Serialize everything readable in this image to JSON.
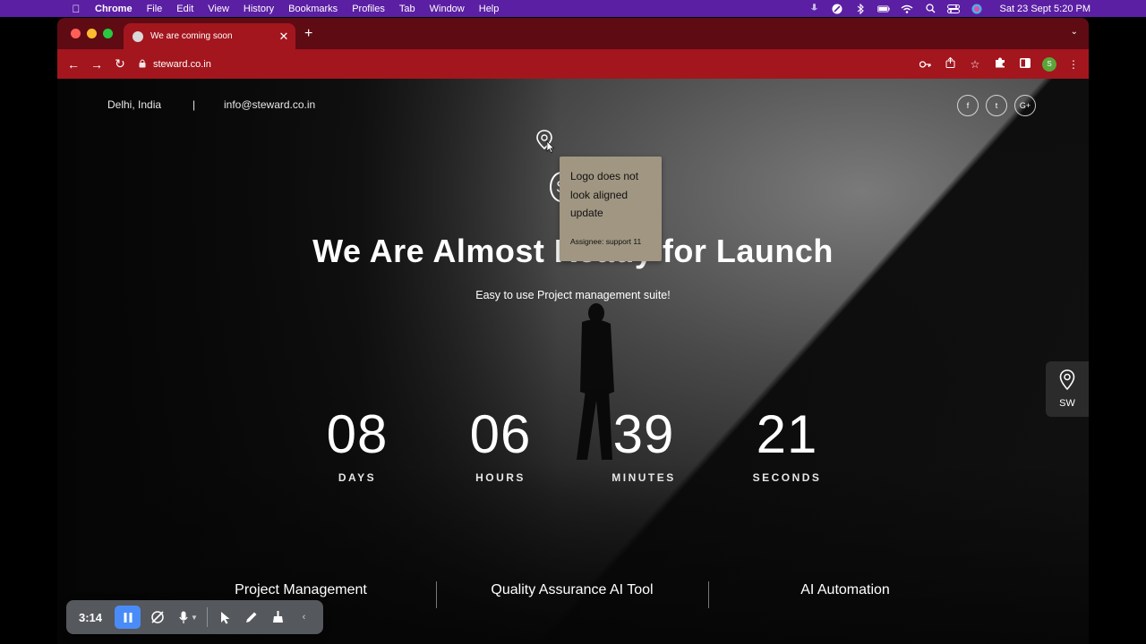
{
  "menubar": {
    "app": "Chrome",
    "items": [
      "File",
      "Edit",
      "View",
      "History",
      "Bookmarks",
      "Profiles",
      "Tab",
      "Window",
      "Help"
    ],
    "clock": "Sat 23 Sept  5:20 PM"
  },
  "browser": {
    "tab_title": "We are coming soon",
    "url": "steward.co.in",
    "profile_initial": "S",
    "accent_color": "#a3161e"
  },
  "page": {
    "location": "Delhi, India",
    "separator": "|",
    "email": "info@steward.co.in",
    "social": [
      "f",
      "t",
      "G+"
    ],
    "logo_letter": "S",
    "headline": "We Are Almost Ready for Launch",
    "subheadline": "Easy to use Project management suite!",
    "countdown": [
      {
        "value": "08",
        "label": "DAYS"
      },
      {
        "value": "06",
        "label": "HOURS"
      },
      {
        "value": "39",
        "label": "MINUTES"
      },
      {
        "value": "21",
        "label": "SECONDS"
      }
    ],
    "features": [
      "Project Management",
      "Quality Assurance AI Tool",
      "AI Automation"
    ]
  },
  "annotation": {
    "text_lines": [
      "Logo does not",
      "look aligned",
      "update"
    ],
    "assignee": "Assignee: support 11",
    "color": "#a09682"
  },
  "side_widget": {
    "label": "SW"
  },
  "recorder": {
    "time": "3:14"
  }
}
